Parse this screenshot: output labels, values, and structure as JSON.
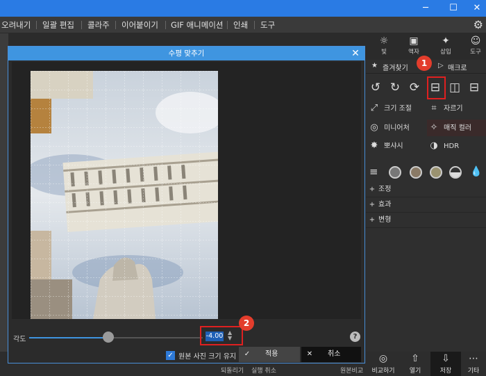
{
  "window": {
    "minimize": "─",
    "maximize": "☐",
    "close": "✕"
  },
  "menu": {
    "items": [
      "오려내기",
      "일괄 편집",
      "콜라주",
      "이어붙이기",
      "GIF 애니메이션",
      "인쇄",
      "도구"
    ],
    "settings_icon": "gear-icon"
  },
  "toolbar": {
    "light": "빛",
    "frame": "액자",
    "insert": "삽입",
    "tools": "도구"
  },
  "panel": {
    "favorites": "즐겨찾기",
    "macro": "매크로",
    "tools": [
      {
        "label": "크기 조절",
        "icon": "resize-icon"
      },
      {
        "label": "자르기",
        "icon": "crop-icon"
      },
      {
        "label": "미니어처",
        "icon": "miniature-icon"
      },
      {
        "label": "매직 컬러",
        "icon": "magic-color-icon"
      },
      {
        "label": "뽀샤시",
        "icon": "soft-glow-icon"
      },
      {
        "label": "HDR",
        "icon": "hdr-icon"
      }
    ],
    "sections": [
      "조정",
      "효과",
      "변형"
    ],
    "marker1": "1"
  },
  "dialog": {
    "title": "수평 맞추기",
    "angle_label": "각도",
    "angle_value": "-4.00",
    "angle_range": [
      -45,
      45
    ],
    "keep_size_label": "원본 사진 크기 유지",
    "keep_size_checked": true,
    "apply": "적용",
    "cancel": "취소",
    "marker2": "2",
    "help": "?"
  },
  "bottom": {
    "undo": "되돌리기",
    "redo_cancel": "실행 취소",
    "compare_original": "원본비교",
    "compare": "비교하기",
    "open": "열기",
    "save": "저장",
    "more": "기타"
  },
  "colors": {
    "accent": "#2a7be4",
    "dialog_title": "#3f95e0",
    "highlight": "#e02020",
    "marker": "#e33d2c"
  }
}
